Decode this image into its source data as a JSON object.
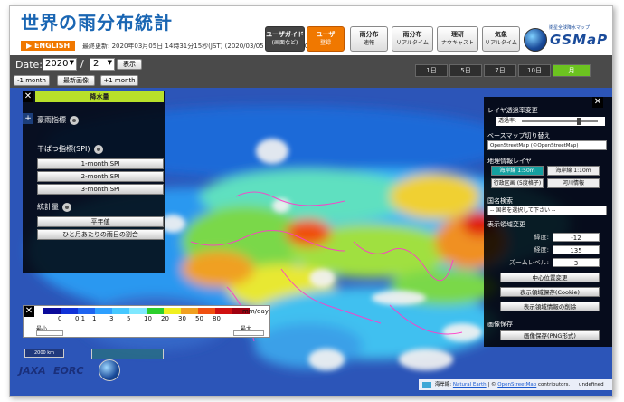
{
  "header": {
    "title": "世界の雨分布統計",
    "english": "▶ ENGLISH",
    "last_updated": "最終更新: 2020年03月05日 14時31分15秒(JST) (2020/03/05 05:31:15 UTC)",
    "nav": {
      "user_guide": "ユーザガイド",
      "user_guide_sub": "(画面など)",
      "user_reg": "ユーザ",
      "user_reg_sub": "登録",
      "rain_flash": "雨分布",
      "rain_flash_sub": "速報",
      "rain_realtime": "雨分布",
      "rain_realtime_sub": "リアルタイム",
      "riken": "理研",
      "riken_sub": "ナウキャスト",
      "weather": "気象",
      "weather_sub": "リアルタイム"
    },
    "logo_text": "GSMaP",
    "logo_sub": "衛星全球降水マップ"
  },
  "datebar": {
    "date_label": "Date:",
    "year": "2020",
    "slash": "/",
    "month": "2",
    "display": "表示",
    "prev_month": "-1 month",
    "latest": "最新画像",
    "next_month": "+1 month",
    "ranges": [
      "1日",
      "5日",
      "7日",
      "10日",
      "月"
    ],
    "active_range": "月"
  },
  "left_panel": {
    "close": "✕",
    "rain_amount": "降水量",
    "heavy_rain_heading": "豪雨指標",
    "drought_heading": "干ばつ指標(SPI)",
    "spi1": "1-month SPI",
    "spi2": "2-month SPI",
    "spi3": "3-month SPI",
    "stats_heading": "統計量",
    "normal": "平年値",
    "rain_ratio": "ひと月あたりの雨日の割合",
    "plus": "+"
  },
  "legend": {
    "close": "✕",
    "colors": [
      "#0a0a9a",
      "#1032d8",
      "#1e64f0",
      "#2ea0ff",
      "#46c8ff",
      "#7fe8ff",
      "#2ccf2c",
      "#f0f020",
      "#f0a020",
      "#f05010",
      "#d01010",
      "#a00010"
    ],
    "ticks": [
      "0",
      "0.1",
      "1",
      "3",
      "5",
      "10",
      "20",
      "30",
      "50",
      "80"
    ],
    "unit": "mm/day",
    "min": "最小",
    "max": "最大"
  },
  "scale": "2000 km",
  "logos": {
    "jaxa": "JAXA",
    "eorc": "EORC"
  },
  "right_panel": {
    "close": "✕",
    "layer_opacity": "レイヤ透過率変更",
    "opacity_label": "透過率:",
    "opacity_value": 0.75,
    "basemap_heading": "ベースマップ切り替え",
    "basemap": "OpenStreetMap (©OpenStreetMap)",
    "geo_heading": "地理情報レイヤ",
    "coast1": "海岸線 1:50m",
    "coast2": "海岸線 1:10m",
    "admin": "行政区画 (5度格子)",
    "river": "河川情報",
    "country_heading": "国名検索",
    "country_placeholder": "-- 国名を選択して下さい --",
    "region_heading": "表示領域変更",
    "lat_label": "緯度:",
    "lat": "-12",
    "lon_label": "経度:",
    "lon": "135",
    "zoom_label": "ズームレベル:",
    "zoom": "3",
    "center": "中心位置変更",
    "save_cookie": "表示領域保存(Cookie)",
    "delete_info": "表示領域情報の削除",
    "image_save_heading": "画像保存",
    "image_save": "画像保存(PNG形式)"
  },
  "attribution": {
    "coastline_prefix": "海岸線:",
    "natural_earth": "Natural Earth",
    "osm_prefix": "©",
    "osm": "OpenStreetMap",
    "contributors": "contributors.",
    "undefined": "undefined"
  }
}
